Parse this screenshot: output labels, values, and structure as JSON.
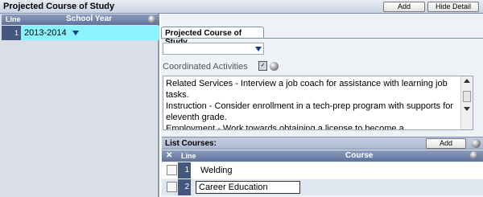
{
  "window": {
    "title": "Projected Course of Study"
  },
  "toolbar": {
    "add_label": "Add",
    "hide_detail_label": "Hide Detail"
  },
  "left_grid": {
    "col_line": "Line",
    "col_school_year": "School Year",
    "rows": [
      {
        "line": "1",
        "school_year": "2013-2014"
      }
    ]
  },
  "detail": {
    "tab_label": "Projected Course of Study",
    "dropdown_value": "",
    "coordinated_label": "Coordinated Activities",
    "coordinated_text": "Related Services - Interview a job coach for assistance with learning job tasks.\nInstruction - Consider enrollment in a tech-prep program with supports for eleventh grade.\nEmployment - Work towards obtaining a license to become a"
  },
  "courses": {
    "section_label": "List Courses:",
    "add_label": "Add",
    "col_line": "Line",
    "col_course": "Course",
    "rows": [
      {
        "line": "1",
        "course": "Welding"
      },
      {
        "line": "2",
        "course": "Career Education"
      }
    ]
  },
  "colors": {
    "selected_row": "#8af3ff",
    "header_dark": "#44577f"
  }
}
